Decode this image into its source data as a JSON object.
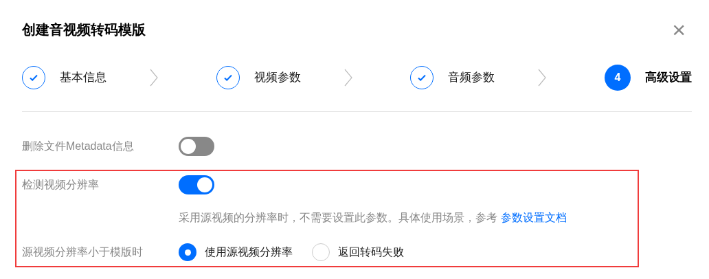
{
  "dialog": {
    "title": "创建音视频转码模版",
    "close": "×"
  },
  "steps": [
    {
      "label": "基本信息",
      "completed": true
    },
    {
      "label": "视频参数",
      "completed": true
    },
    {
      "label": "音频参数",
      "completed": true
    },
    {
      "label": "高级设置",
      "completed": false,
      "number": "4"
    }
  ],
  "fields": [
    {
      "label": "删除文件Metadata信息",
      "kind": "switch",
      "on": false
    }
  ],
  "highlighted_fields": [
    {
      "label": "检测视频分辨率",
      "kind": "switch",
      "on": true,
      "hint": "采用源视频的分辨率时，不需要设置此参数。具体使用场景，参考",
      "link": "参数设置文档"
    },
    {
      "label": "源视频分辨率小于模版时",
      "kind": "radio",
      "options": [
        {
          "label": "使用源视频分辨率",
          "selected": true
        },
        {
          "label": "返回转码失败",
          "selected": false
        }
      ]
    }
  ]
}
